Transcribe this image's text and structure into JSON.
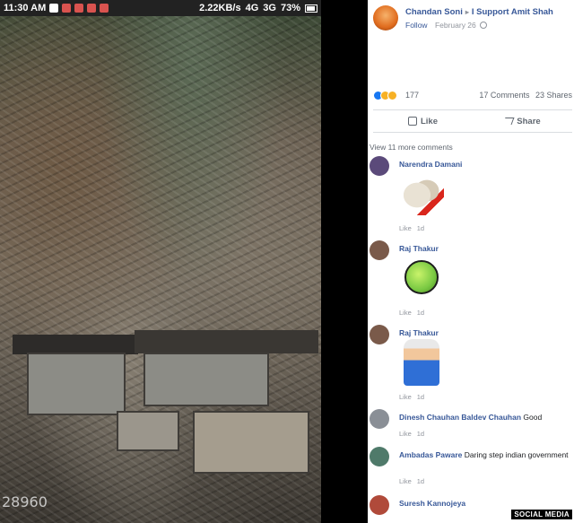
{
  "status_bar": {
    "time": "11:30 AM",
    "speed": "2.22KB/s",
    "network_left": "4G",
    "network_right": "3G",
    "battery": "73%"
  },
  "photo": {
    "counter": "28960"
  },
  "post": {
    "author": "Chandan Soni",
    "group": "I Support Amit Shah",
    "follow_label": "Follow",
    "date": "February 26",
    "reaction_count": "177",
    "comments_count": "17 Comments",
    "shares_count": "23 Shares",
    "like_label": "Like",
    "share_label": "Share",
    "view_more": "View 11 more comments"
  },
  "comments": [
    {
      "name": "Narendra Damani",
      "text": "",
      "like": "Like",
      "time": "1d",
      "sticker": "clapping-hands-sticker"
    },
    {
      "name": "Raj Thakur",
      "text": "",
      "like": "Like",
      "time": "1d",
      "sticker": "green-face-sticker"
    },
    {
      "name": "Raj Thakur",
      "text": "",
      "like": "Like",
      "time": "1d",
      "sticker": "cool-character-sticker"
    },
    {
      "name": "Dinesh Chauhan Baldev Chauhan",
      "text": "Good",
      "like": "Like",
      "time": "1d"
    },
    {
      "name": "Ambadas Paware",
      "text": "Daring step indian government",
      "like": "Like",
      "time": "1d"
    },
    {
      "name": "Suresh Kannojeya",
      "text": ""
    }
  ],
  "credit": "SOCIAL MEDIA",
  "colors": {
    "link_blue": "#385898",
    "meta_gray": "#90949c",
    "credit_bg": "#000000"
  }
}
